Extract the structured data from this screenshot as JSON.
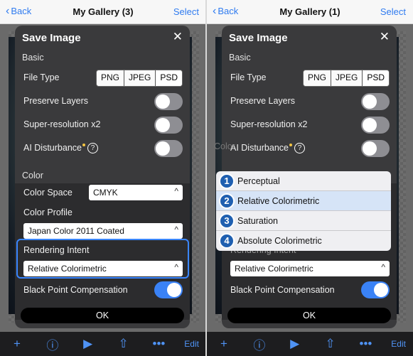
{
  "nav": {
    "back_label": "Back",
    "select_label": "Select"
  },
  "left": {
    "title": "My Gallery (3)"
  },
  "right": {
    "title": "My Gallery (1)"
  },
  "dialog": {
    "title": "Save Image",
    "basic_heading": "Basic",
    "file_type_label": "File Type",
    "file_types": [
      "PNG",
      "JPEG",
      "PSD"
    ],
    "selected_file_type": "PSD",
    "preserve_layers_label": "Preserve Layers",
    "preserve_layers_on": false,
    "super_res_label": "Super-resolution x2",
    "super_res_on": false,
    "ai_label": "AI Disturbance",
    "ai_on": false,
    "help_glyph": "?",
    "color_heading": "Color",
    "color_space_label": "Color Space",
    "color_space_value": "CMYK",
    "color_profile_label": "Color Profile",
    "color_profile_value": "Japan Color 2011 Coated",
    "rendering_intent_label": "Rendering Intent",
    "rendering_intent_value": "Relative Colorimetric",
    "black_point_label": "Black Point Compensation",
    "black_point_on": true,
    "ok_label": "OK",
    "caret_glyph": "^"
  },
  "popup": {
    "items": [
      {
        "num": "1",
        "label": "Perceptual"
      },
      {
        "num": "2",
        "label": "Relative Colorimetric"
      },
      {
        "num": "3",
        "label": "Saturation"
      },
      {
        "num": "4",
        "label": "Absolute Colorimetric"
      }
    ],
    "selected_index": 1
  },
  "toolbar": {
    "edit_label": "Edit",
    "icons": [
      "plus-icon",
      "info-icon",
      "play-icon",
      "share-icon",
      "more-icon"
    ]
  },
  "colors": {
    "accent": "#2f7bf0",
    "toggle_on": "#3a82f6",
    "highlight": "#3a86ff",
    "dialog_bg": "#3a3a3c"
  }
}
